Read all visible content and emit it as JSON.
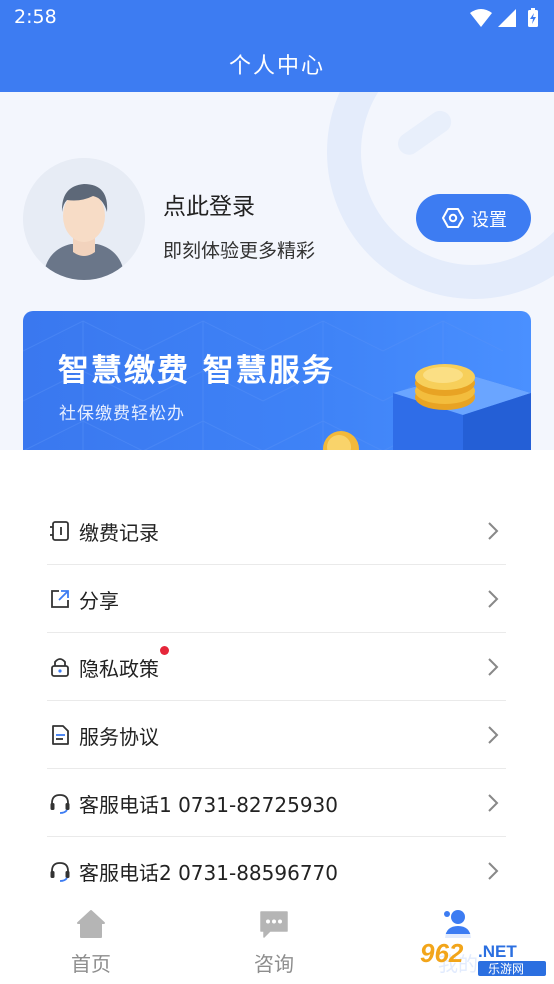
{
  "status_bar": {
    "time": "2:58"
  },
  "header": {
    "title": "个人中心"
  },
  "profile": {
    "login_title": "点此登录",
    "login_subtitle": "即刻体验更多精彩",
    "settings_label": "设置"
  },
  "banner": {
    "title": "智慧缴费  智慧服务",
    "subtitle": "社保缴费轻松办"
  },
  "menu": {
    "items": [
      {
        "label": "缴费记录",
        "icon": "bill-record-icon"
      },
      {
        "label": "分享",
        "icon": "share-icon"
      },
      {
        "label": "隐私政策",
        "icon": "lock-icon",
        "badge": "red-dot"
      },
      {
        "label": "服务协议",
        "icon": "document-icon"
      },
      {
        "label": "客服电话1 0731-82725930",
        "icon": "headset-icon"
      },
      {
        "label": "客服电话2 0731-88596770",
        "icon": "headset-icon"
      }
    ]
  },
  "bottom_nav": {
    "items": [
      {
        "label": "首页",
        "icon": "home-icon"
      },
      {
        "label": "咨询",
        "icon": "chat-icon"
      },
      {
        "label": "我的",
        "icon": "user-icon"
      }
    ]
  },
  "watermark": {
    "text": "962.NET",
    "subtext": "乐游网"
  },
  "colors": {
    "primary": "#3d7cf2",
    "profile_bg": "#f3f6fd",
    "badge_red": "#e5263a",
    "nav_inactive": "#8d8d8d"
  }
}
